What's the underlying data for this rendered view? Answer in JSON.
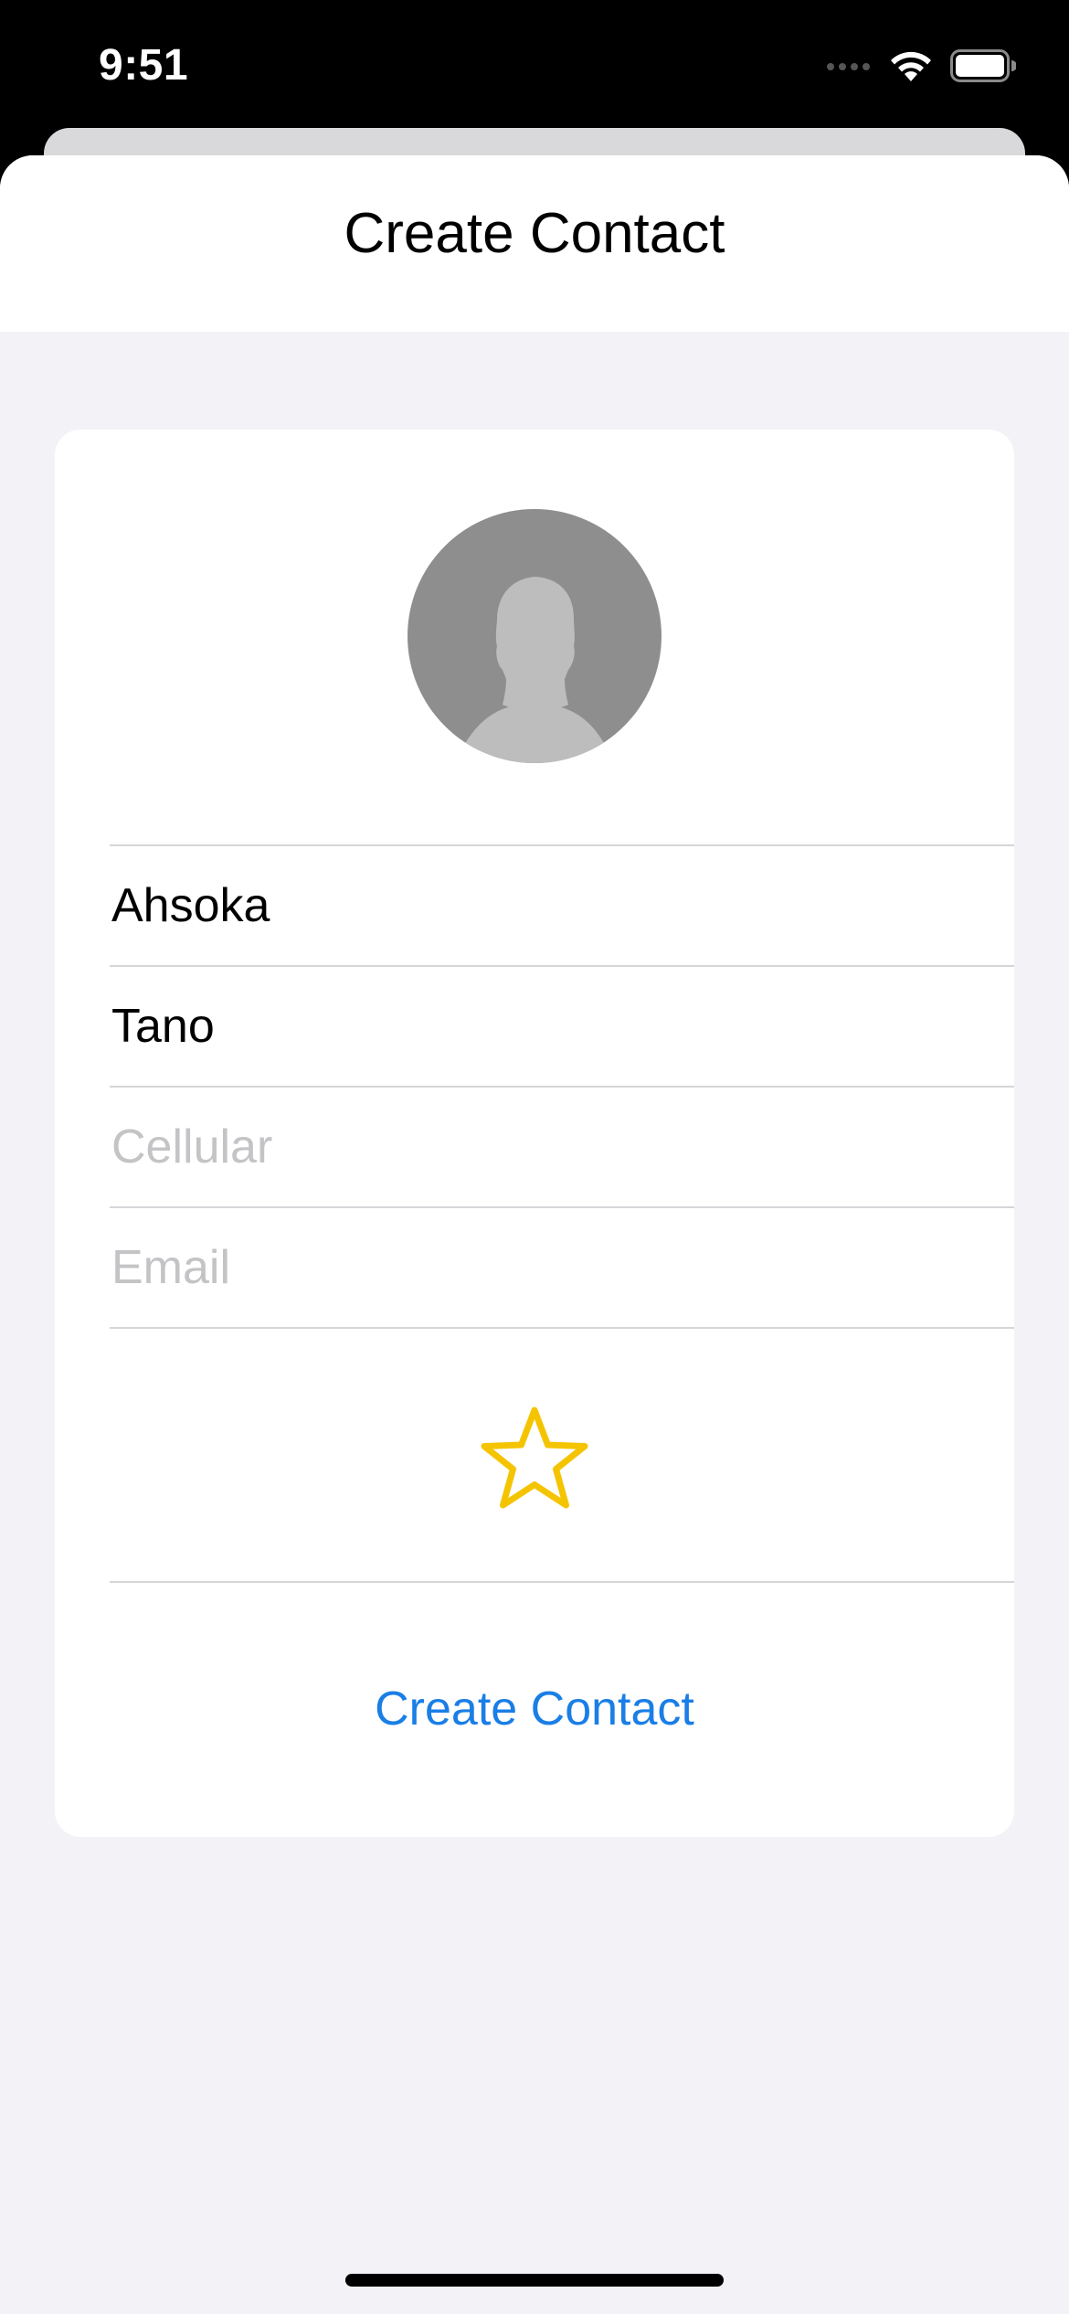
{
  "status_bar": {
    "time": "9:51",
    "icons": [
      "signal-dots-icon",
      "wifi-icon",
      "battery-icon"
    ]
  },
  "nav": {
    "title": "Create Contact"
  },
  "form": {
    "first_name": {
      "value": "Ahsoka",
      "placeholder": ""
    },
    "last_name": {
      "value": "Tano",
      "placeholder": ""
    },
    "cellular": {
      "value": "",
      "placeholder": "Cellular"
    },
    "email": {
      "value": "",
      "placeholder": "Email"
    },
    "favorite_icon": "star-outline-icon",
    "create_button_label": "Create Contact"
  },
  "colors": {
    "accent": "#1a7ee6",
    "star": "#f5c400",
    "background": "#f2f2f7",
    "avatar": "#8e8e8e"
  }
}
